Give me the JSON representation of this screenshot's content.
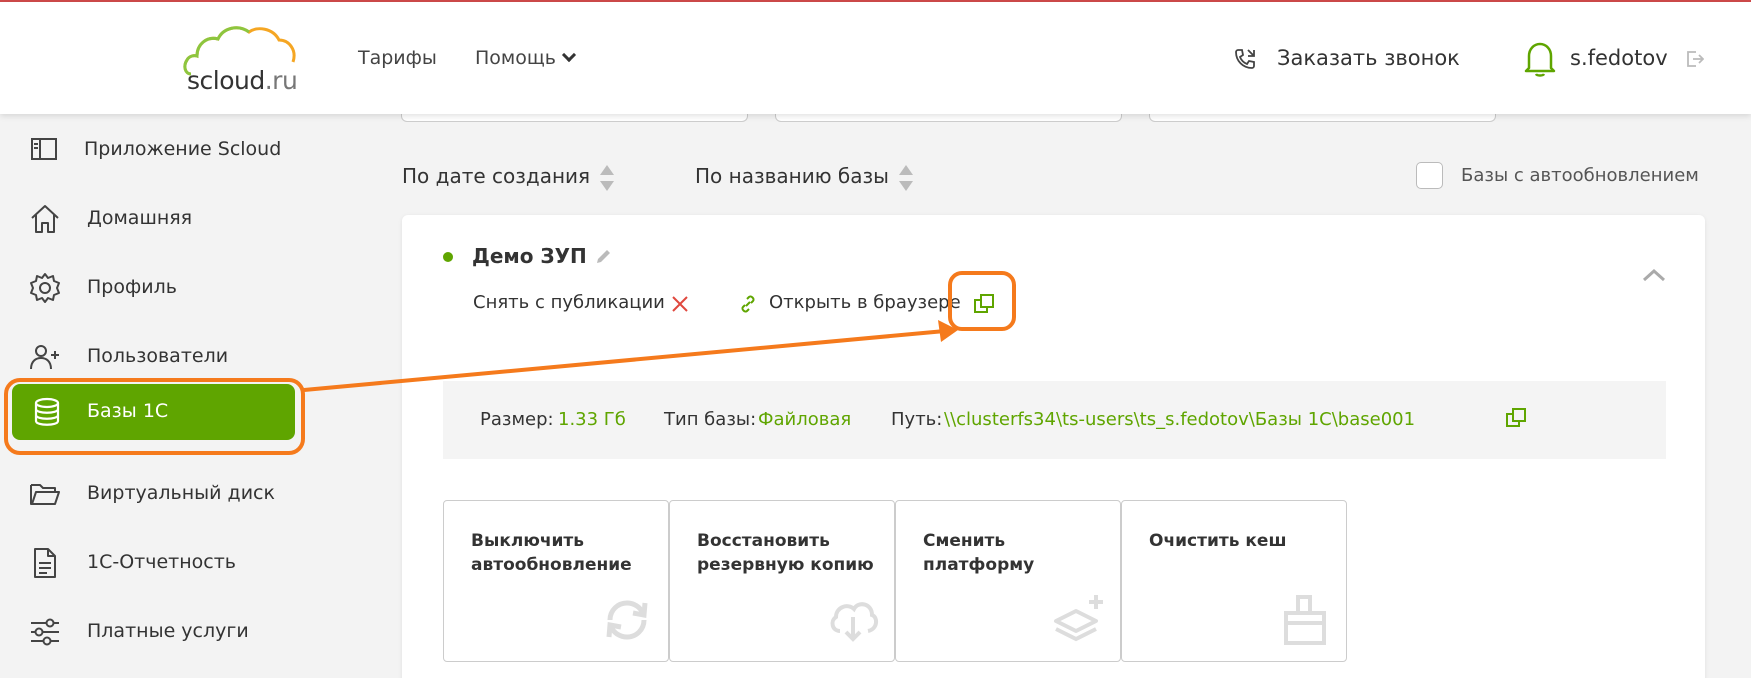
{
  "header": {
    "logo_text": "scloud",
    "logo_suffix": ".ru",
    "nav": {
      "tariffs": "Тарифы",
      "help": "Помощь"
    },
    "order_call": "Заказать звонок",
    "username": "s.fedotov"
  },
  "sidebar": {
    "items": [
      {
        "label": "Приложение Scloud",
        "icon": "app-panel-icon"
      },
      {
        "label": "Домашняя",
        "icon": "home-icon"
      },
      {
        "label": "Профиль",
        "icon": "gear-icon"
      },
      {
        "label": "Пользователи",
        "icon": "add-user-icon"
      },
      {
        "label": "Базы 1С",
        "icon": "database-icon",
        "active": true
      },
      {
        "label": "Виртуальный диск",
        "icon": "folder-icon"
      },
      {
        "label": "1С-Отчетность",
        "icon": "document-icon"
      },
      {
        "label": "Платные услуги",
        "icon": "sliders-icon"
      }
    ]
  },
  "sort": {
    "by_date": "По дате создания",
    "by_name": "По названию базы",
    "autoupdate_filter": "Базы с автообновлением"
  },
  "database": {
    "name": "Демо ЗУП",
    "unpublish": "Снять с публикации",
    "open_in_browser": "Открыть в браузере",
    "size_label": "Размер:",
    "size_value": "1.33 Гб",
    "type_label": "Тип базы:",
    "type_value": "Файловая",
    "path_label": "Путь:",
    "path_value": "\\\\clusterfs34\\ts-users\\ts_s.fedotov\\Базы 1С\\base001"
  },
  "actions": [
    {
      "line1": "Выключить",
      "line2": "автообновление",
      "icon": "refresh-icon"
    },
    {
      "line1": "Восстановить",
      "line2": "резервную копию",
      "icon": "cloud-download-icon"
    },
    {
      "line1": "Сменить",
      "line2": "платформу",
      "icon": "layers-add-icon"
    },
    {
      "line1": "Очистить кеш",
      "line2": "",
      "icon": "brush-icon"
    }
  ],
  "colors": {
    "accent": "#5fa500",
    "annotation": "#f57a1c",
    "close": "#e0483e"
  }
}
